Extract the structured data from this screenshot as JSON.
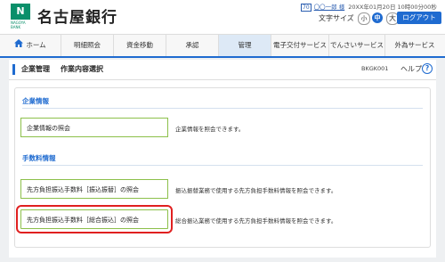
{
  "header": {
    "bank_name": "名古屋銀行",
    "logo_text": "N",
    "logo_sub": "NAGOYA BANK",
    "user_badge": "70",
    "user_name": "〇〇一郎 様",
    "last_login": "20XX年01月20日 10時00分00秒",
    "fontsize_label": "文字サイズ",
    "fontsize_small": "小",
    "fontsize_mid": "中",
    "fontsize_large": "大",
    "logout_label": "ログアウト"
  },
  "nav": [
    {
      "label": "ホーム",
      "active": false
    },
    {
      "label": "明細照会",
      "active": false
    },
    {
      "label": "資金移動",
      "active": false
    },
    {
      "label": "承認",
      "active": false
    },
    {
      "label": "管理",
      "active": true
    },
    {
      "label": "電子交付サービス",
      "active": false
    },
    {
      "label": "でんさいサービス",
      "active": false
    },
    {
      "label": "外為サービス",
      "active": false
    }
  ],
  "page": {
    "crumb1": "企業管理",
    "crumb2": "作業内容選択",
    "screen_id": "BKGK001",
    "help_label": "ヘルプ",
    "help_icon": "?"
  },
  "sections": {
    "company": {
      "title": "企業情報",
      "button": "企業情報の照会",
      "desc": "企業情報を照会できます。"
    },
    "fees": {
      "title": "手数料情報",
      "button1": "先方負担振込手数料［振込振替］の照会",
      "desc1": "振込振替業務で使用する先方負担手数料情報を照会できます。",
      "button2": "先方負担振込手数料［総合振込］の照会",
      "desc2": "総合振込業務で使用する先方負担手数料情報を照会できます。"
    }
  },
  "colors": {
    "accent": "#1f6bd0",
    "brand": "#0a8f6a",
    "button_border": "#8cc04a",
    "highlight": "#e02020"
  }
}
